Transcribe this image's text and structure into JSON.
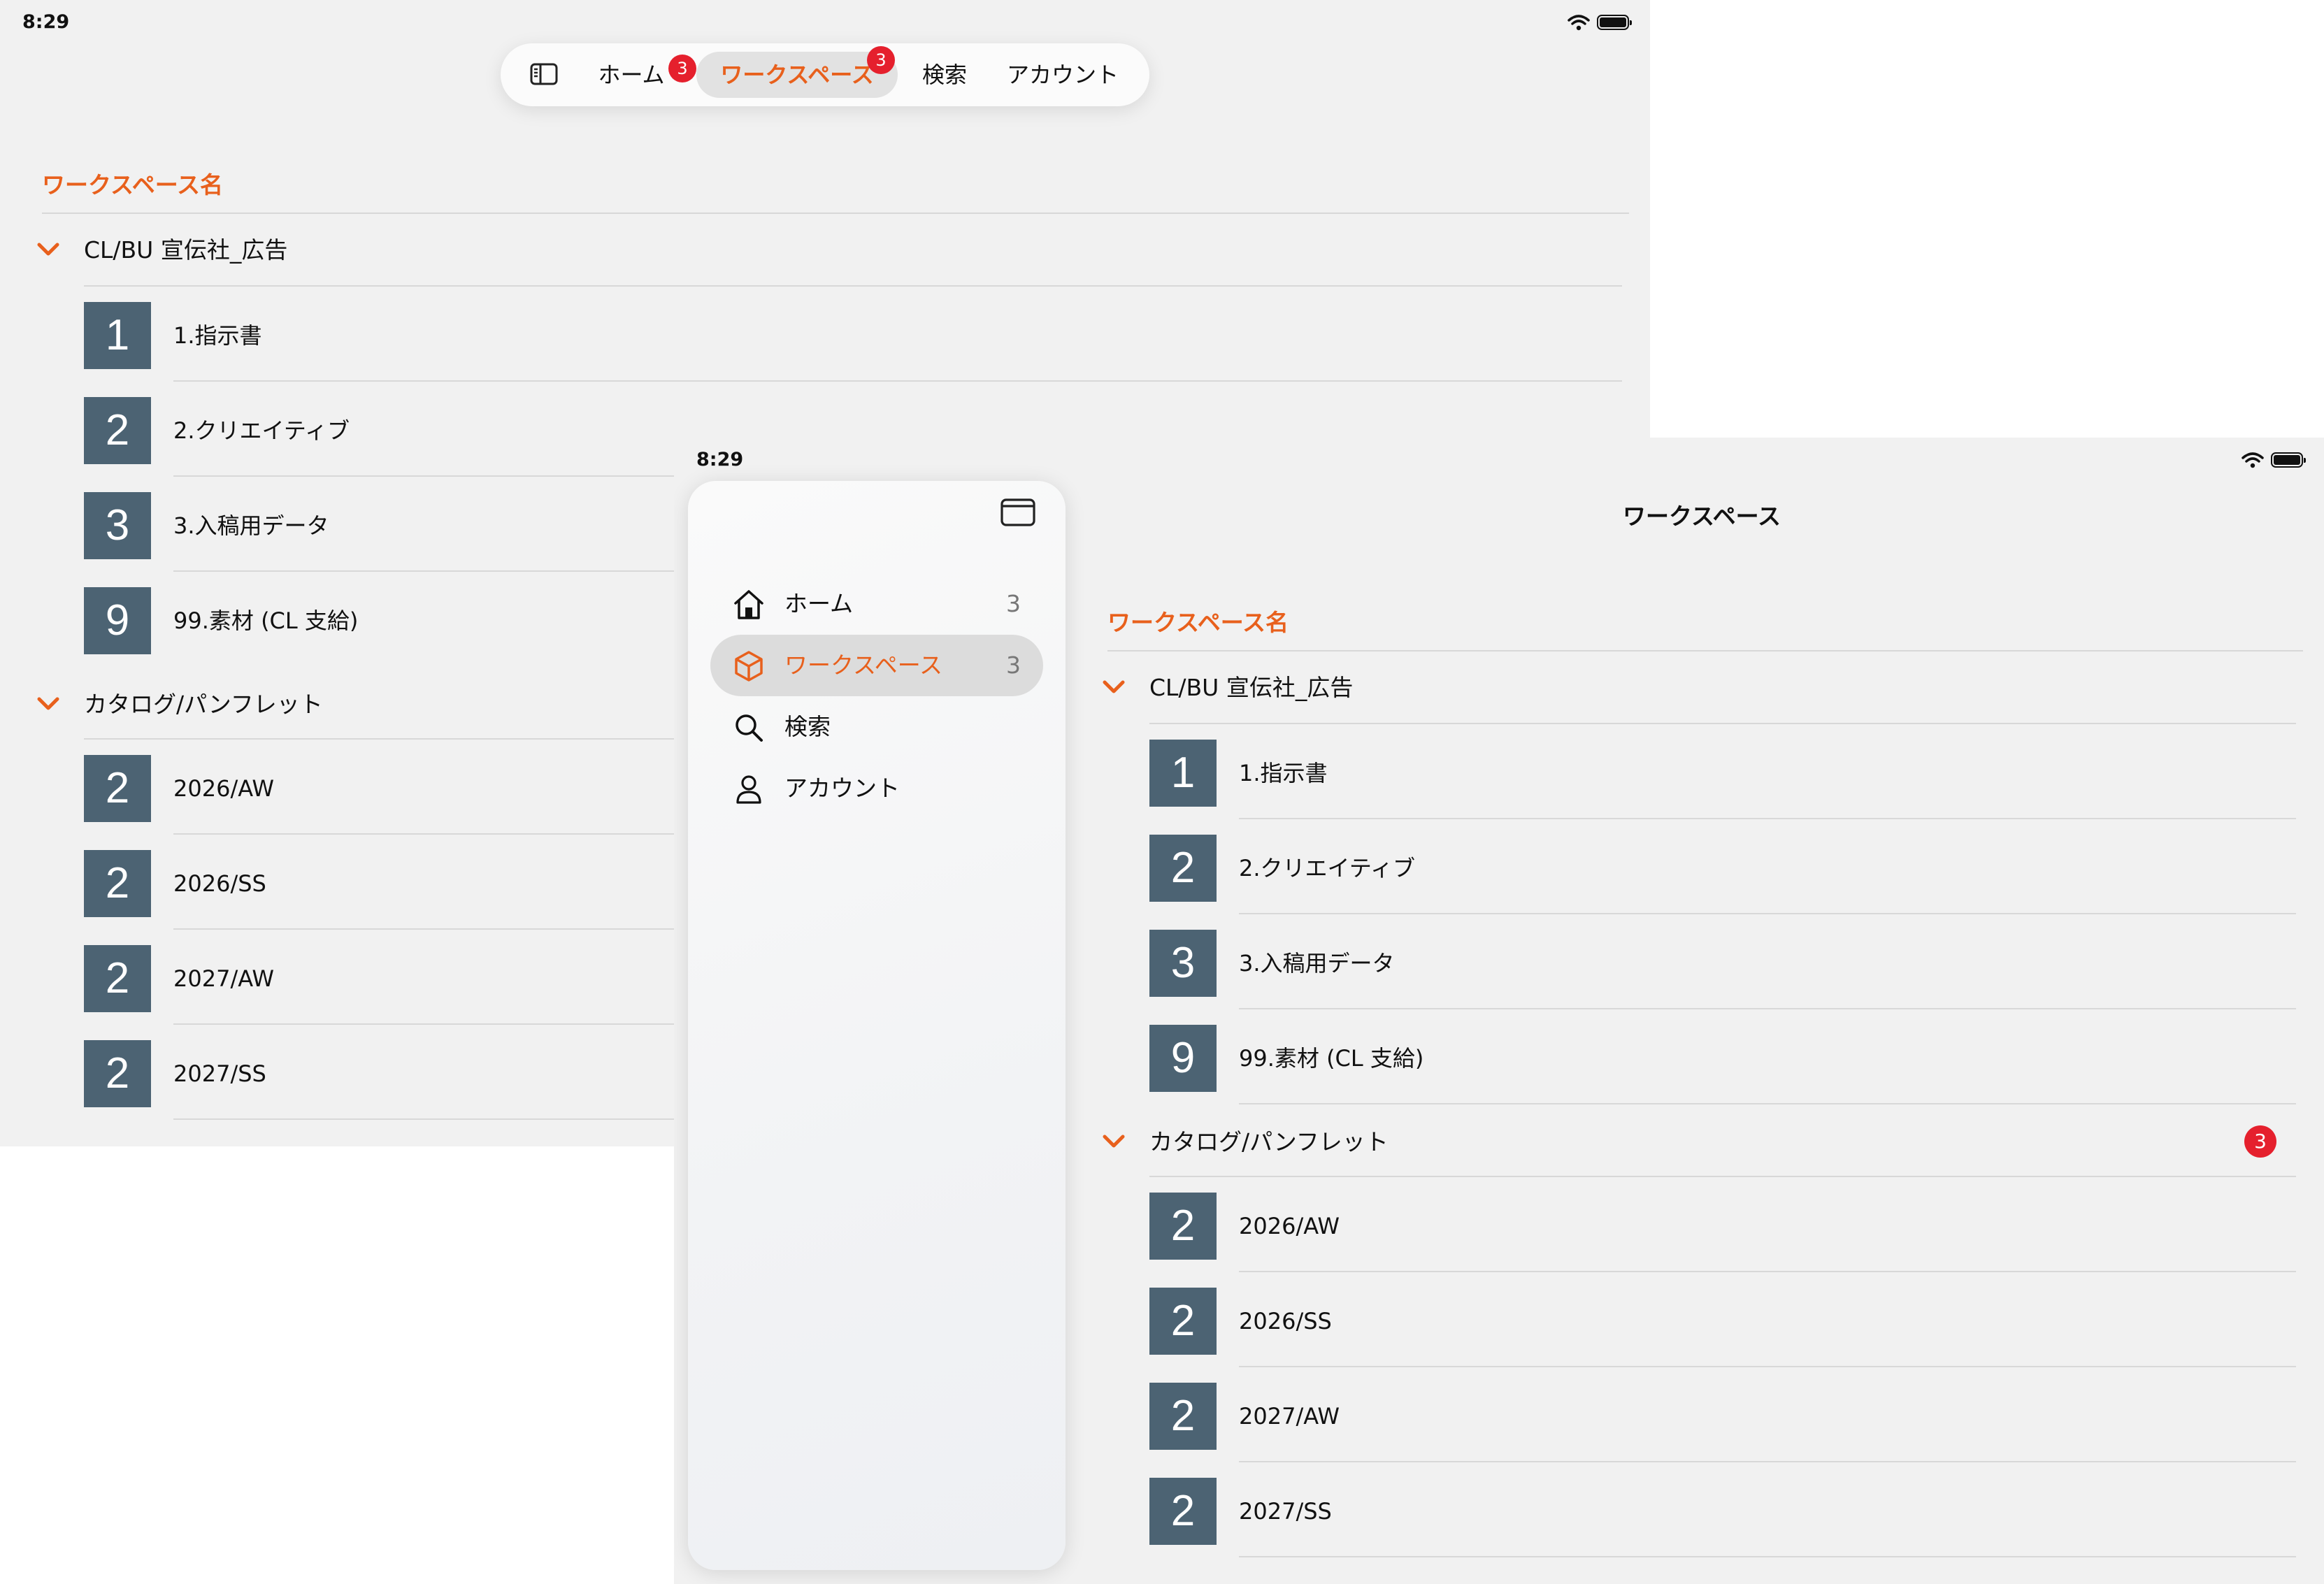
{
  "screen1": {
    "status_time": "8:29",
    "tabbar": {
      "toggle_icon": "sidebar-toggle-icon",
      "tabs": [
        {
          "label": "ホーム",
          "badge": "3"
        },
        {
          "label": "ワークスペース",
          "badge": "3",
          "selected": true
        },
        {
          "label": "検索"
        },
        {
          "label": "アカウント"
        }
      ]
    },
    "section_header": "ワークスペース名",
    "groups": [
      {
        "label": "CL/BU 宣伝社_広告",
        "items": [
          {
            "icon": "1",
            "label": "1.指示書"
          },
          {
            "icon": "2",
            "label": "2.クリエイティブ"
          },
          {
            "icon": "3",
            "label": "3.入稿用データ"
          },
          {
            "icon": "9",
            "label": "99.素材 (CL 支給)"
          }
        ]
      },
      {
        "label": "カタログ/パンフレット",
        "items": [
          {
            "icon": "2",
            "label": "2026/AW"
          },
          {
            "icon": "2",
            "label": "2026/SS"
          },
          {
            "icon": "2",
            "label": "2027/AW"
          },
          {
            "icon": "2",
            "label": "2027/SS"
          }
        ]
      }
    ]
  },
  "screen2": {
    "status_time": "8:29",
    "nav_title": "ワークスペース",
    "sidebar": {
      "collapse_icon": "sidebar-collapse-icon",
      "items": [
        {
          "icon": "home-icon",
          "label": "ホーム",
          "count": "3"
        },
        {
          "icon": "cube-icon",
          "label": "ワークスペース",
          "count": "3",
          "selected": true
        },
        {
          "icon": "search-icon",
          "label": "検索"
        },
        {
          "icon": "person-icon",
          "label": "アカウント"
        }
      ]
    },
    "section_header": "ワークスペース名",
    "groups": [
      {
        "label": "CL/BU 宣伝社_広告",
        "items": [
          {
            "icon": "1",
            "label": "1.指示書"
          },
          {
            "icon": "2",
            "label": "2.クリエイティブ"
          },
          {
            "icon": "3",
            "label": "3.入稿用データ"
          },
          {
            "icon": "9",
            "label": "99.素材 (CL 支給)"
          }
        ]
      },
      {
        "label": "カタログ/パンフレット",
        "badge": "3",
        "items": [
          {
            "icon": "2",
            "label": "2026/AW"
          },
          {
            "icon": "2",
            "label": "2026/SS"
          },
          {
            "icon": "2",
            "label": "2027/AW"
          },
          {
            "icon": "2",
            "label": "2027/SS"
          }
        ]
      }
    ]
  },
  "colors": {
    "accent": "#e8601c",
    "badge": "#e5202d",
    "folder_icon_bg": "#4c6373",
    "background": "#f1f1f1"
  }
}
